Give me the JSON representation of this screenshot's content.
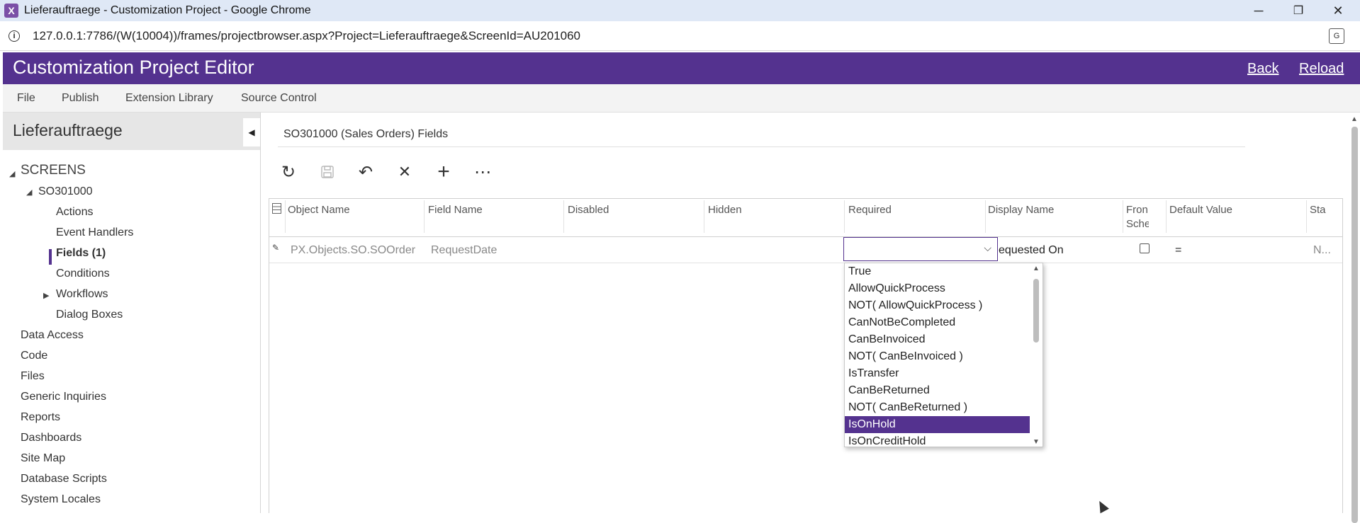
{
  "window": {
    "title": "Lieferauftraege - Customization Project - Google Chrome",
    "url": "127.0.0.1:7786/(W(10004))/frames/projectbrowser.aspx?Project=Lieferauftraege&ScreenId=AU201060",
    "minimize": "─",
    "restore": "❐",
    "close": "✕"
  },
  "header": {
    "title": "Customization Project Editor",
    "back_label": "Back",
    "reload_label": "Reload"
  },
  "menu": [
    "File",
    "Publish",
    "Extension Library",
    "Source Control"
  ],
  "sidebar": {
    "project_name": "Lieferauftraege",
    "screens_label": "SCREENS",
    "screen_id": "SO301000",
    "screen_children": [
      "Actions",
      "Event Handlers",
      "Fields (1)",
      "Conditions",
      "Workflows",
      "Dialog Boxes"
    ],
    "other_items": [
      "Data Access",
      "Code",
      "Files",
      "Generic Inquiries",
      "Reports",
      "Dashboards",
      "Site Map",
      "Database Scripts",
      "System Locales"
    ]
  },
  "main": {
    "title": "SO301000 (Sales Orders) Fields",
    "toolbar": {
      "refresh_icon": "↻",
      "save_icon": "💾",
      "undo_icon": "↶",
      "delete_icon": "✕",
      "add_icon": "+",
      "more_icon": "⋯"
    },
    "columns": [
      "Object Name",
      "Field Name",
      "Disabled",
      "Hidden",
      "Required",
      "Display Name",
      "Fron\nSche",
      "Default Value",
      "Sta"
    ],
    "row": {
      "object_name": "PX.Objects.SO.SOOrder",
      "field_name": "RequestDate",
      "required": "",
      "display_name": "equested On",
      "from_schema": false,
      "default_value": "=",
      "status": "N..."
    }
  },
  "dropdown": {
    "options": [
      "True",
      "AllowQuickProcess",
      "NOT( AllowQuickProcess )",
      "CanNotBeCompleted",
      "CanBeInvoiced",
      "NOT( CanBeInvoiced )",
      "IsTransfer",
      "CanBeReturned",
      "NOT( CanBeReturned )",
      "IsOnHold",
      "IsOnCreditHold"
    ],
    "selected": "IsOnHold"
  },
  "colors": {
    "accent": "#54328f",
    "titlebar": "#dfe8f6"
  }
}
